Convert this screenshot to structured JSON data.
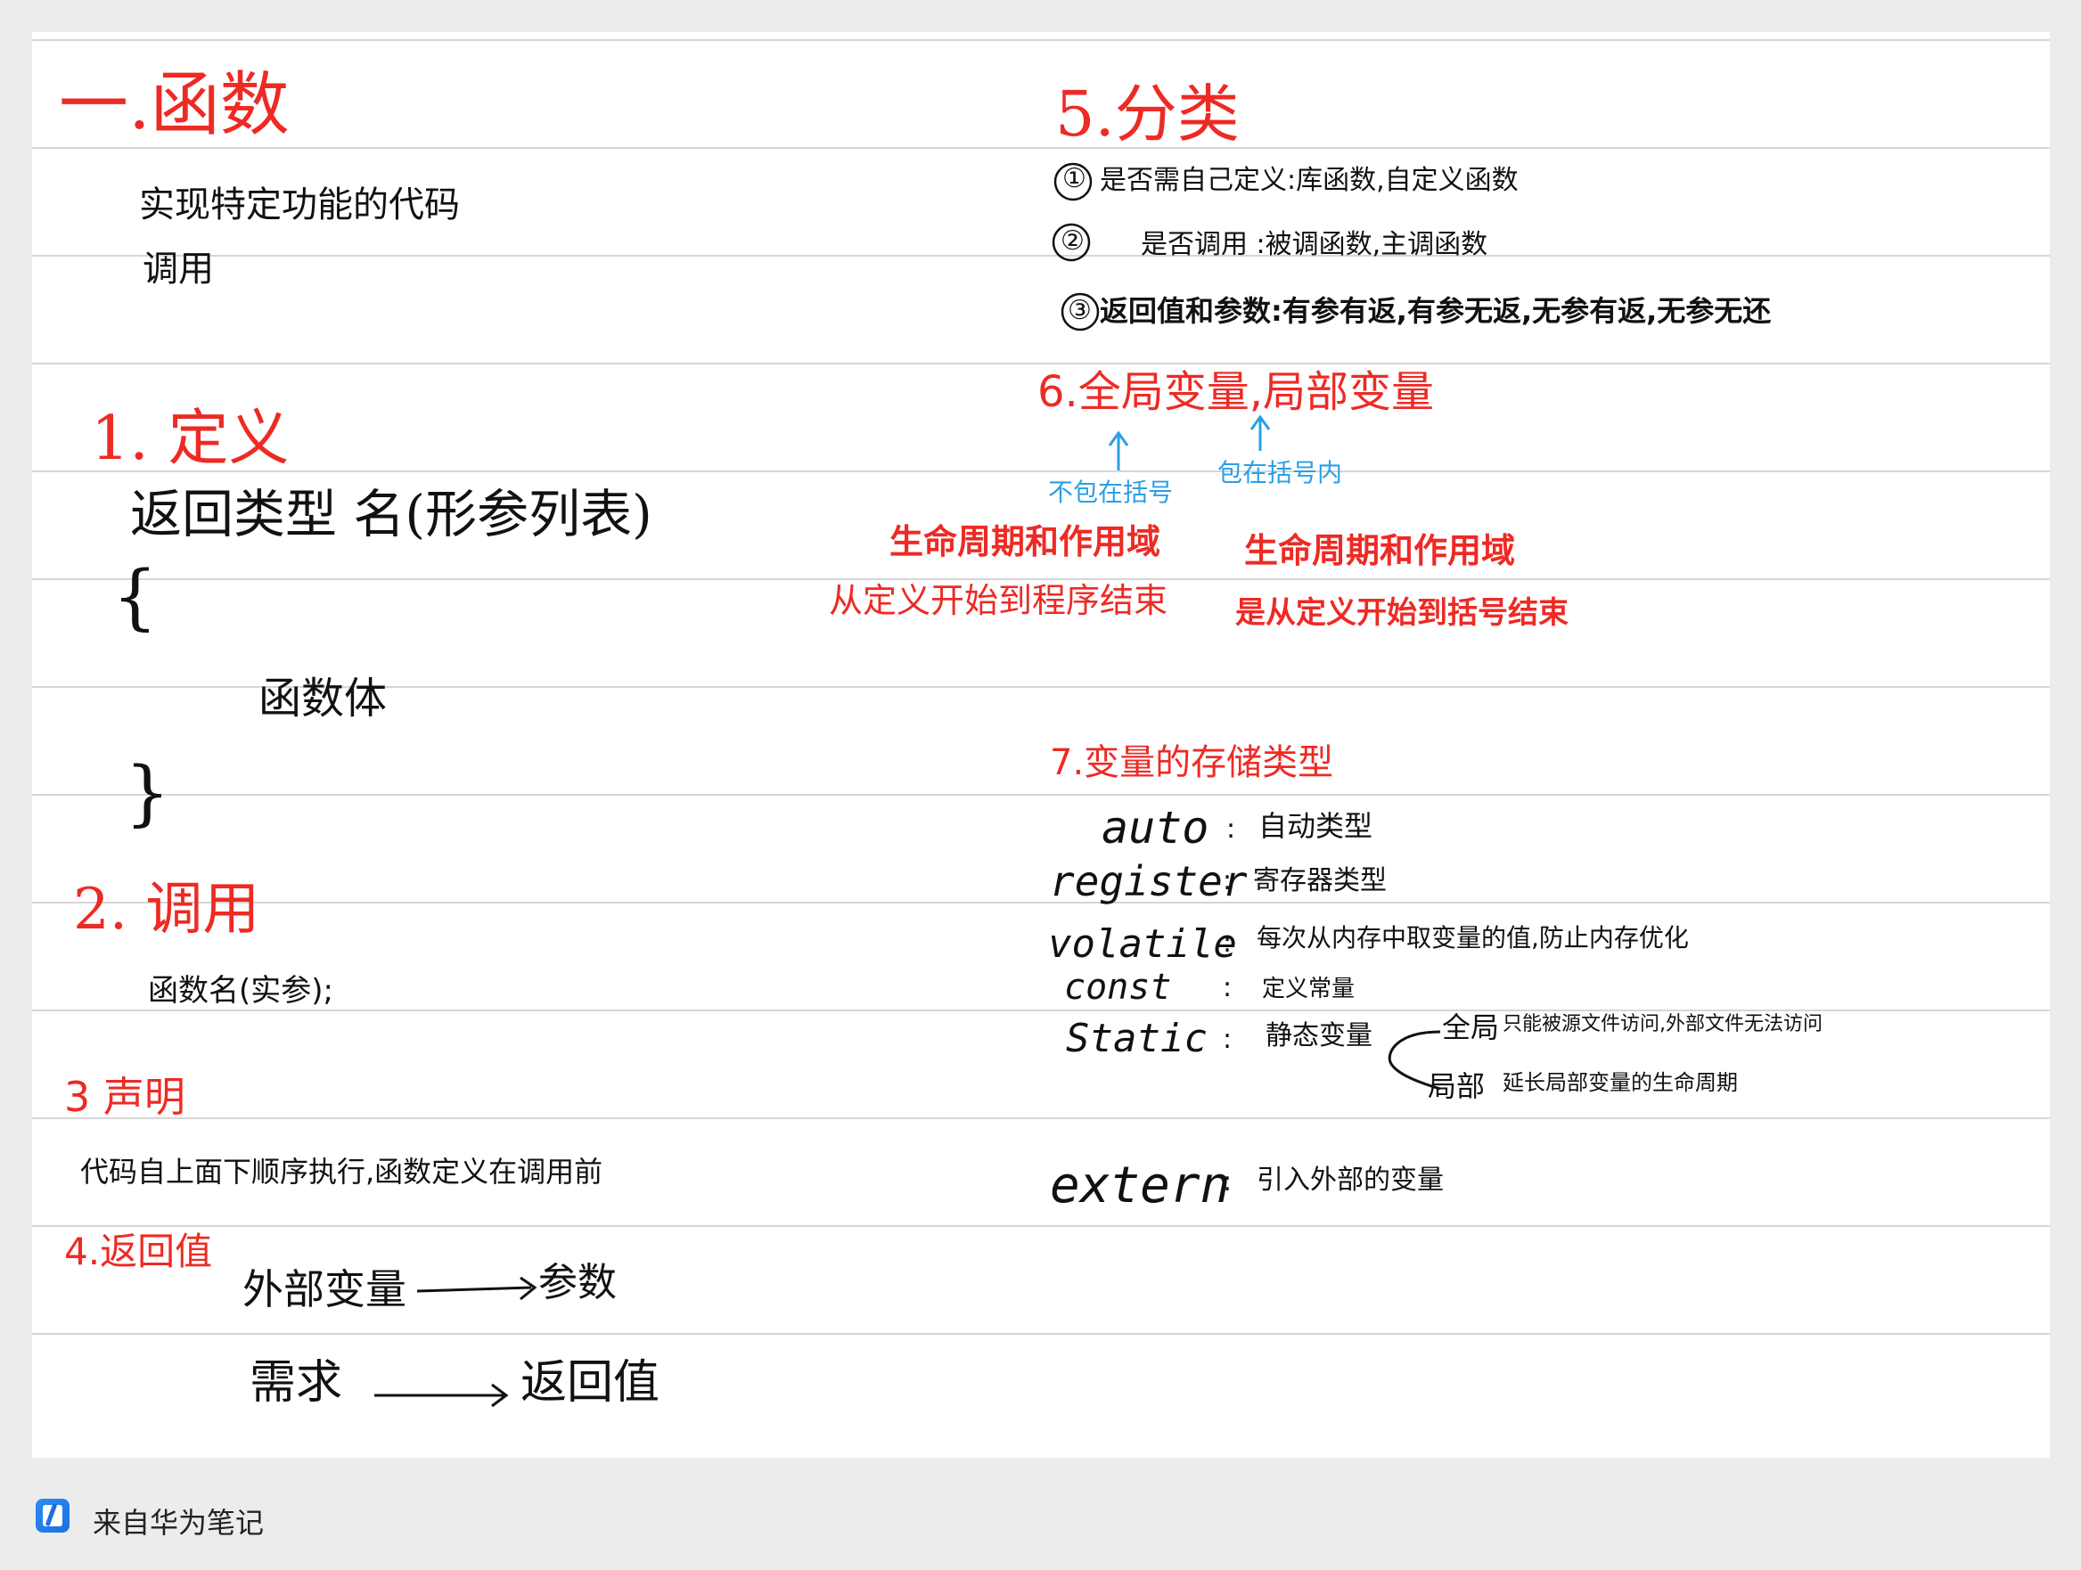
{
  "left": {
    "h1": "一.函数",
    "intro": [
      "实现特定功能的代码",
      "调用"
    ],
    "h_define": "1. 定义",
    "define_signature": "返回类型   名(形参列表)",
    "brace_open": "{",
    "function_body": "函数体",
    "brace_close": "}",
    "h_call": "2. 调用",
    "call_syntax": "函数名(实参);",
    "h_declare": "3 声明",
    "declare_text": "代码自上面下顺序执行,函数定义在调用前",
    "h_return": "4.返回值",
    "return_rows": [
      {
        "from": "外部变量",
        "to": "参数"
      },
      {
        "from": "需求",
        "to": "返回值"
      }
    ]
  },
  "right": {
    "h_classify": "5.分类",
    "classify": [
      {
        "num": "①",
        "text": "是否需自己定义:库函数,自定义函数"
      },
      {
        "num": "②",
        "text": "是否调用 :被调函数,主调函数"
      },
      {
        "num": "③",
        "text": "返回值和参数:有参有返,有参无返,无参有返,无参无还"
      }
    ],
    "h_scope": "6.全局变量,局部变量",
    "scope_notes": [
      {
        "label": "不包在括号",
        "lifetime": "生命周期和作用域",
        "range": "从定义开始到程序结束"
      },
      {
        "label": "包在括号内",
        "lifetime": "生命周期和作用域",
        "range": "是从定义开始到括号结束"
      }
    ],
    "h_storage": "7.变量的存储类型",
    "storage": [
      {
        "kw": "auto",
        "desc": "自动类型"
      },
      {
        "kw": "register",
        "desc": "寄存器类型"
      },
      {
        "kw": "volatile",
        "desc": "每次从内存中取变量的值,防止内存优化"
      },
      {
        "kw": "const",
        "desc": "定义常量"
      },
      {
        "kw": "Static",
        "desc": "静态变量"
      },
      {
        "kw": "extern",
        "desc": "引入外部的变量"
      }
    ],
    "static_branches": [
      {
        "scope": "全局",
        "desc": "只能被源文件访问,外部文件无法访问"
      },
      {
        "scope": "局部",
        "desc": "延长局部变量的生命周期"
      }
    ],
    "colon": ":"
  },
  "footer": {
    "label": "来自华为笔记"
  },
  "colors": {
    "heading": "#ee2a24",
    "note": "#2a9fe6",
    "ink": "#111111",
    "rule": "#d6d6d6"
  }
}
